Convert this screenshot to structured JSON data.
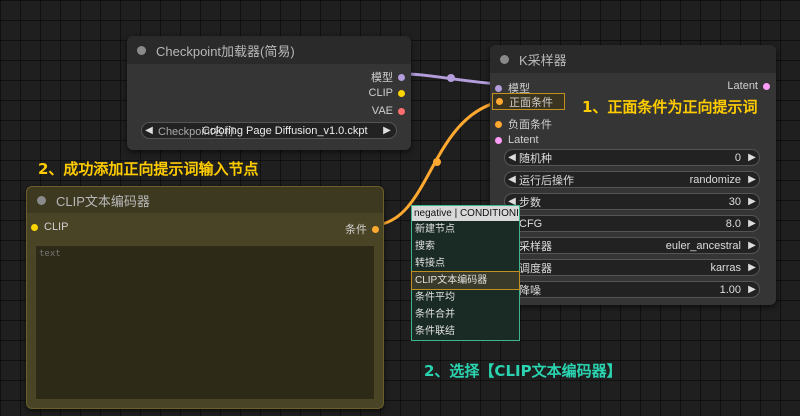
{
  "colors": {
    "model": "#b39ddb",
    "clip": "#ffd500",
    "vae": "#ff6e6e",
    "conditioning": "#ffa931",
    "latent": "#ff9cf9",
    "annotation_yellow": "#ffcc00",
    "annotation_teal": "#2ad4b0"
  },
  "checkpoint": {
    "title": "Checkpoint加载器(简易)",
    "outputs": {
      "model": "模型",
      "clip": "CLIP",
      "vae": "VAE"
    },
    "ckpt_label": "Checkpoint名称",
    "ckpt_value": "Coloring Page Diffusion_v1.0.ckpt"
  },
  "ksampler": {
    "title": "K采样器",
    "inputs": {
      "model": "模型",
      "positive": "正面条件",
      "negative": "负面条件",
      "latent": "Latent"
    },
    "output_latent": "Latent",
    "widgets": [
      {
        "label": "随机种",
        "value": "0"
      },
      {
        "label": "运行后操作",
        "value": "randomize"
      },
      {
        "label": "步数",
        "value": "30"
      },
      {
        "label": "CFG",
        "value": "8.0"
      },
      {
        "label": "采样器",
        "value": "euler_ancestral"
      },
      {
        "label": "调度器",
        "value": "karras"
      },
      {
        "label": "降噪",
        "value": "1.00"
      }
    ]
  },
  "clip_encoder": {
    "title": "CLIP文本编码器",
    "input_clip": "CLIP",
    "output": "条件",
    "text_placeholder": "text"
  },
  "menu": {
    "header": "negative | CONDITIONING",
    "items": [
      "新建节点",
      "搜索",
      "转接点",
      "CLIP文本编码器",
      "条件平均",
      "条件合并",
      "条件联结"
    ]
  },
  "annotations": {
    "step1": "1、正面条件为正向提示词",
    "step2_node": "2、成功添加正向提示词输入节点",
    "step2_select": "2、选择【CLIP文本编码器】"
  }
}
